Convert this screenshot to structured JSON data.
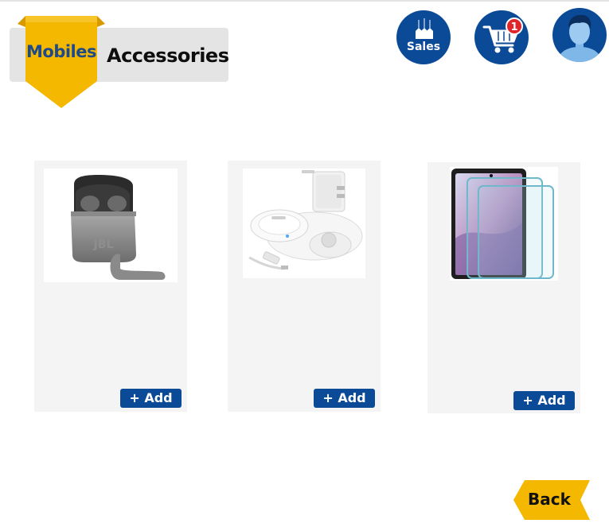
{
  "tabs": {
    "mobiles_label": "Mobiles",
    "accessories_label": "Accessories",
    "active": "Mobiles"
  },
  "header": {
    "sales_label": "Sales",
    "cart_count": "1"
  },
  "products": [
    {
      "image": "wireless earbuds in charging case",
      "add_label": "+ Add"
    },
    {
      "image": "wireless charging pad with wall adapter and cable",
      "add_label": "+ Add"
    },
    {
      "image": "smartphone screen protectors",
      "add_label": "+ Add"
    }
  ],
  "back_label": "Back",
  "colors": {
    "primary": "#0a4a97",
    "accent": "#f5b800",
    "card": "#f4f4f4",
    "badge": "#e0262b"
  }
}
